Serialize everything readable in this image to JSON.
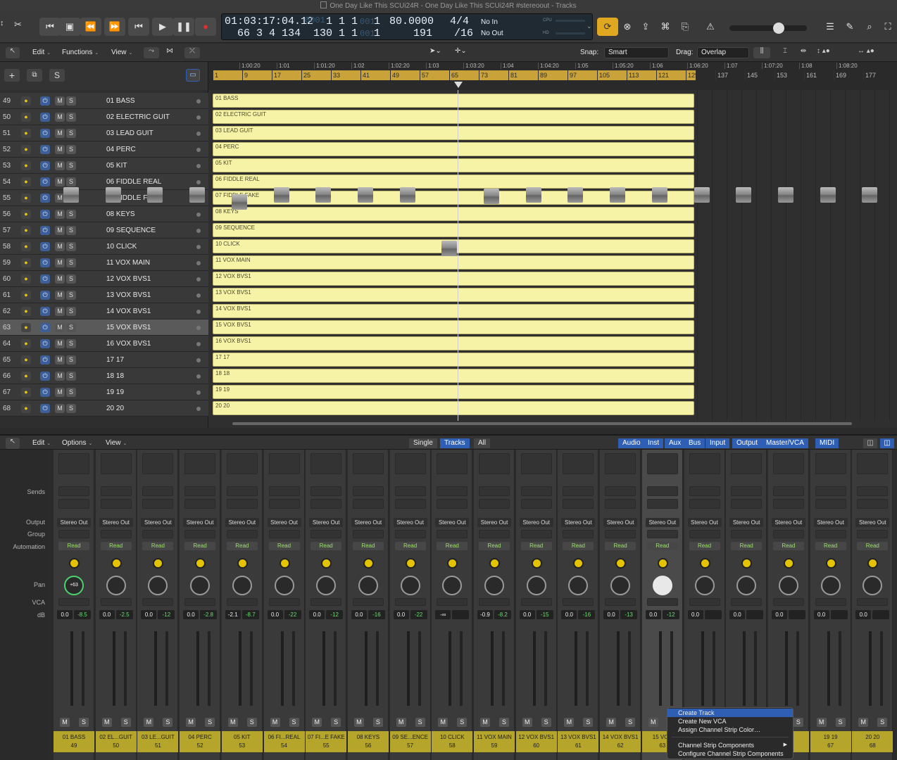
{
  "window": {
    "title": "One Day Like This SCUi24R - One Day Like This SCUi24R #stereoout - Tracks"
  },
  "lcd": {
    "time": "01:03:17:04.12",
    "bars_top": "1  1  1",
    "bars_top_dim": "0001",
    "bars_top_end": "1",
    "bars": "66  3  4  134",
    "bars_b": "130  1  1",
    "bars_b_dim": "001",
    "bars_b_end": "1",
    "tempo": "80.0000",
    "tempo_sub": "191",
    "sig": "4/4",
    "div": "/16",
    "in": "No In",
    "out": "No Out",
    "cpu": "CPU",
    "hd": "HD"
  },
  "toolbar": {
    "edit": "Edit",
    "functions": "Functions",
    "view": "View",
    "snap_label": "Snap:",
    "snap": "Smart",
    "drag_label": "Drag:",
    "drag": "Overlap"
  },
  "track_header": {
    "add": "+",
    "s": "S"
  },
  "ruler": {
    "times": [
      "1:00:20",
      "1:01",
      "1:01:20",
      "1:02",
      "1:02:20",
      "1:03",
      "1:03:20",
      "1:04",
      "1:04:20",
      "1:05",
      "1:05:20",
      "1:06",
      "1:06:20",
      "1:07",
      "1:07:20",
      "1:08",
      "1:08:20"
    ],
    "bars": [
      "1",
      "9",
      "17",
      "25",
      "33",
      "41",
      "49",
      "57",
      "65",
      "73",
      "81",
      "89",
      "97",
      "105",
      "113",
      "121",
      "129",
      "137",
      "145",
      "153",
      "161",
      "169",
      "177"
    ]
  },
  "tracks": [
    {
      "num": "49",
      "name": "01 BASS"
    },
    {
      "num": "50",
      "name": "02 ELECTRIC GUIT"
    },
    {
      "num": "51",
      "name": "03 LEAD GUIT"
    },
    {
      "num": "52",
      "name": "04 PERC"
    },
    {
      "num": "53",
      "name": "05 KIT"
    },
    {
      "num": "54",
      "name": "06 FIDDLE REAL"
    },
    {
      "num": "55",
      "name": "07 FIDDLE FAKE"
    },
    {
      "num": "56",
      "name": "08 KEYS"
    },
    {
      "num": "57",
      "name": "09 SEQUENCE"
    },
    {
      "num": "58",
      "name": "10 CLICK"
    },
    {
      "num": "59",
      "name": "11 VOX MAIN"
    },
    {
      "num": "60",
      "name": "12 VOX BVS1"
    },
    {
      "num": "61",
      "name": "13 VOX BVS1"
    },
    {
      "num": "62",
      "name": "14 VOX BVS1"
    },
    {
      "num": "63",
      "name": "15 VOX BVS1"
    },
    {
      "num": "64",
      "name": "16 VOX BVS1"
    },
    {
      "num": "65",
      "name": "17 17"
    },
    {
      "num": "66",
      "name": "18 18"
    },
    {
      "num": "67",
      "name": "19 19"
    },
    {
      "num": "68",
      "name": "20  20"
    }
  ],
  "track_button_labels": {
    "m": "M",
    "s": "S"
  },
  "mixer_bar": {
    "edit": "Edit",
    "options": "Options",
    "view": "View",
    "single": "Single",
    "tracks": "Tracks",
    "all": "All",
    "filters": [
      "Audio",
      "Inst",
      "Aux",
      "Bus",
      "Input",
      "Output",
      "Master/VCA",
      "MIDI"
    ]
  },
  "mixer_labels": {
    "sends": "Sends",
    "output": "Output",
    "group": "Group",
    "automation": "Automation",
    "pan": "Pan",
    "vca": "VCA",
    "db": "dB"
  },
  "strips": [
    {
      "name": "01 BASS",
      "num": "49",
      "out": "Stereo Out",
      "auto": "Read",
      "vol": "0.0",
      "peak": "-8.5",
      "pan": "+63"
    },
    {
      "name": "02 EL...GUIT",
      "num": "50",
      "out": "Stereo Out",
      "auto": "Read",
      "vol": "0.0",
      "peak": "-2.5",
      "pan": ""
    },
    {
      "name": "03 LE...GUIT",
      "num": "51",
      "out": "Stereo Out",
      "auto": "Read",
      "vol": "0.0",
      "peak": "-12",
      "pan": ""
    },
    {
      "name": "04 PERC",
      "num": "52",
      "out": "Stereo Out",
      "auto": "Read",
      "vol": "0.0",
      "peak": "-2.8",
      "pan": ""
    },
    {
      "name": "05 KIT",
      "num": "53",
      "out": "Stereo Out",
      "auto": "Read",
      "vol": "-2.1",
      "peak": "-8.7",
      "pan": ""
    },
    {
      "name": "06 FI...REAL",
      "num": "54",
      "out": "Stereo Out",
      "auto": "Read",
      "vol": "0.0",
      "peak": "-22",
      "pan": ""
    },
    {
      "name": "07 FI...E FAKE",
      "num": "55",
      "out": "Stereo Out",
      "auto": "Read",
      "vol": "0.0",
      "peak": "-12",
      "pan": ""
    },
    {
      "name": "08 KEYS",
      "num": "56",
      "out": "Stereo Out",
      "auto": "Read",
      "vol": "0.0",
      "peak": "-16",
      "pan": ""
    },
    {
      "name": "09 SE...ENCE",
      "num": "57",
      "out": "Stereo Out",
      "auto": "Read",
      "vol": "0.0",
      "peak": "-22",
      "pan": ""
    },
    {
      "name": "10 CLICK",
      "num": "58",
      "out": "Stereo Out",
      "auto": "Read",
      "vol": "-∞",
      "peak": "",
      "pan": ""
    },
    {
      "name": "11 VOX MAIN",
      "num": "59",
      "out": "Stereo Out",
      "auto": "Read",
      "vol": "-0.9",
      "peak": "-8.2",
      "pan": ""
    },
    {
      "name": "12 VOX BVS1",
      "num": "60",
      "out": "Stereo Out",
      "auto": "Read",
      "vol": "0.0",
      "peak": "-15",
      "pan": ""
    },
    {
      "name": "13 VOX BVS1",
      "num": "61",
      "out": "Stereo Out",
      "auto": "Read",
      "vol": "0.0",
      "peak": "-16",
      "pan": ""
    },
    {
      "name": "14 VOX BVS1",
      "num": "62",
      "out": "Stereo Out",
      "auto": "Read",
      "vol": "0.0",
      "peak": "-13",
      "pan": ""
    },
    {
      "name": "15 VOX",
      "num": "63",
      "out": "Stereo Out",
      "auto": "Read",
      "vol": "0.0",
      "peak": "-12",
      "pan": ""
    },
    {
      "name": "",
      "num": "",
      "out": "Stereo Out",
      "auto": "Read",
      "vol": "0.0",
      "peak": "",
      "pan": ""
    },
    {
      "name": "",
      "num": "",
      "out": "Stereo Out",
      "auto": "Read",
      "vol": "0.0",
      "peak": "",
      "pan": ""
    },
    {
      "name": "",
      "num": "",
      "out": "Stereo Out",
      "auto": "Read",
      "vol": "0.0",
      "peak": "",
      "pan": ""
    },
    {
      "name": "19 19",
      "num": "67",
      "out": "Stereo Out",
      "auto": "Read",
      "vol": "0.0",
      "peak": "",
      "pan": ""
    },
    {
      "name": "20  20",
      "num": "68",
      "out": "Stereo Out",
      "auto": "Read",
      "vol": "0.0",
      "peak": "",
      "pan": ""
    }
  ],
  "context_menu": {
    "items": [
      "Create Track",
      "Create New VCA",
      "Assign Channel Strip Color…",
      "Channel Strip Components",
      "Configure Channel Strip Components"
    ],
    "submenu_arrow": "▶"
  },
  "colors": {
    "region": "#f6f2a6",
    "ruler_cycle": "#c9a33a",
    "accent": "#2f5fb4",
    "strip_name": "#b5a52a"
  }
}
